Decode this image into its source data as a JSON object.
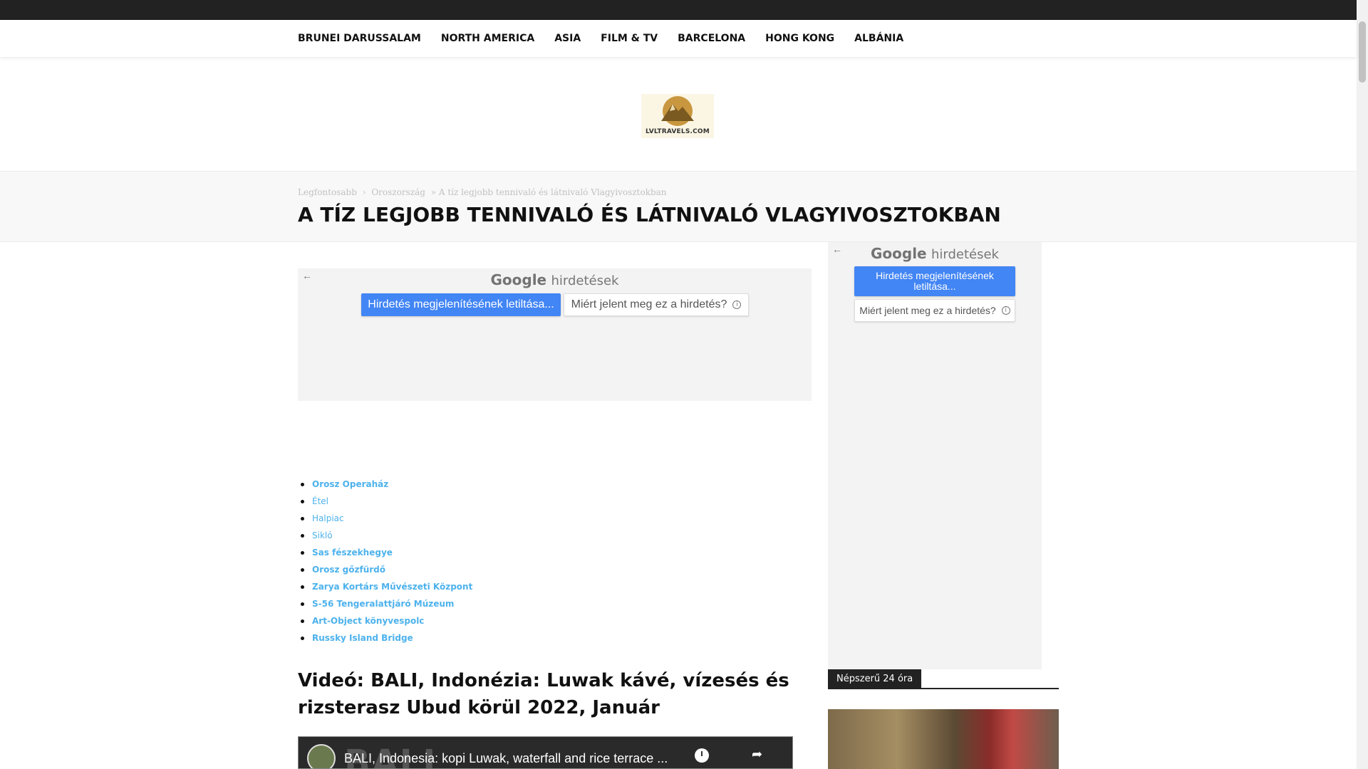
{
  "nav": {
    "items": [
      "BRUNEI DARUSSALAM",
      "NORTH AMERICA",
      "ASIA",
      "FILM & TV",
      "BARCELONA",
      "HONG KONG",
      "ALBÁNIA"
    ]
  },
  "logo": {
    "text": "LVLTRAVELS.COM"
  },
  "breadcrumb": {
    "home": "Legfontosabb",
    "sep": "›",
    "category": "Oroszország",
    "current": "» A tíz legjobb tennivaló és látnivaló Vlagyivosztokban"
  },
  "page": {
    "title": "A TÍZ LEGJOBB TENNIVALÓ ÉS LÁTNIVALÓ VLAGYIVOSZTOKBAN"
  },
  "ad_main": {
    "back": "←",
    "google": "Google",
    "hirdetesek": "hirdetések",
    "stop_label": "Hirdetés megjelenítésének letiltása...",
    "why_label": "Miért jelent meg ez a hirdetés?"
  },
  "ad_side": {
    "back": "←",
    "google": "Google",
    "hirdetesek": "hirdetések",
    "stop_label": "Hirdetés megjelenítésének letiltása...",
    "why_label": "Miért jelent meg ez a hirdetés?"
  },
  "toc": [
    {
      "label": "Orosz Operaház",
      "bold": true
    },
    {
      "label": "Étel",
      "bold": false
    },
    {
      "label": "Halpiac",
      "bold": false
    },
    {
      "label": "Sikló",
      "bold": false
    },
    {
      "label": "Sas fészekhegye",
      "bold": true
    },
    {
      "label": "Orosz gőzfürdő",
      "bold": true
    },
    {
      "label": "Zarya Kortárs Művészeti Központ",
      "bold": true
    },
    {
      "label": "S-56 Tengeralattjáró Múzeum",
      "bold": true
    },
    {
      "label": "Art-Object könyvespolc",
      "bold": true
    },
    {
      "label": "Russky Island Bridge",
      "bold": true
    }
  ],
  "video": {
    "heading": "Videó: BALI, Indonézia: Luwak kávé, vízesés és rizsterasz Ubud körül 2022, Január",
    "caption": "BALI, Indonesia: kopi Luwak, waterfall and rice terrace ...",
    "bg_text": "BALI"
  },
  "sidebar": {
    "popular_label": "Népszerű 24 óra"
  },
  "icons": {
    "back": "arrow-left-icon",
    "info": "info-icon",
    "clock": "clock-icon",
    "share": "share-icon"
  },
  "colors": {
    "link": "#4db2ec",
    "ad_blue": "#4285f4",
    "topbar": "#222222"
  }
}
